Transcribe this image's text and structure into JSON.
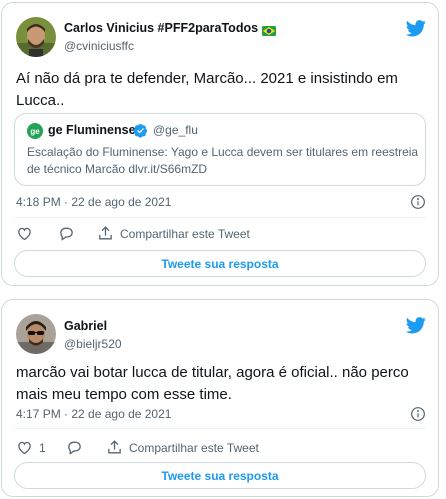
{
  "tweets": [
    {
      "author_name": "Carlos Vinicius #PFF2paraTodos",
      "flag_icon": "brazil-flag-icon",
      "handle": "@cviniciusffc",
      "text": "Aí não dá pra te defender, Marcão... 2021 e insistindo em Lucca..",
      "quote": {
        "avatar_text": "ge",
        "author_name": "ge Fluminense",
        "verified_icon": "verified-badge-icon",
        "handle": "@ge_flu",
        "text": "Escalação do Fluminense: Yago e Lucca devem ser titulares em reestreia de técnico Marcão dlvr.it/S66mZD"
      },
      "timestamp": "4:18 PM · 22 de ago de 2021",
      "like_count": "",
      "share_label": "Compartilhar este Tweet",
      "reply_button": "Tweete sua resposta"
    },
    {
      "author_name": "Gabriel",
      "handle": "@bieljr520",
      "text": "marcão vai botar lucca de titular, agora é oficial.. não perco mais meu tempo com esse time.",
      "timestamp": "4:17 PM · 22 de ago de 2021",
      "like_count": "1",
      "share_label": "Compartilhar este Tweet",
      "reply_button": "Tweete sua resposta"
    }
  ],
  "colors": {
    "accent": "#1d9bf0",
    "text": "#0f1419",
    "secondary": "#536471",
    "border": "#cfd9de",
    "ge_green": "#23a455"
  }
}
